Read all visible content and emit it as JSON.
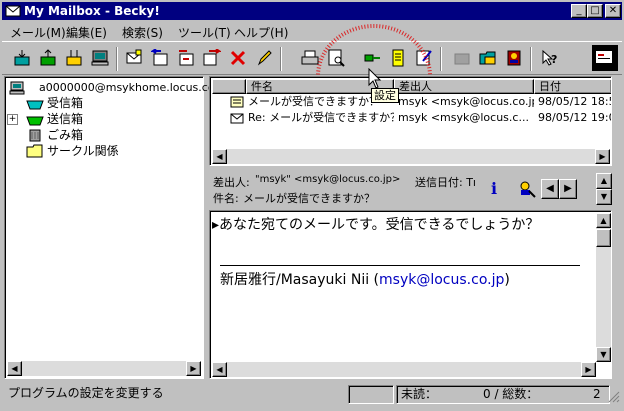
{
  "window": {
    "title": "My Mailbox - Becky!"
  },
  "menu": [
    "メール(M)",
    "編集(E)",
    "検索(S)",
    "ツール(T)",
    "ヘルプ(H)"
  ],
  "toolbar": {
    "icons": [
      "receive-icon",
      "send-icon",
      "send-receive-icon",
      "computer-icon",
      "new-mail-icon",
      "reply-icon",
      "reply-all-icon",
      "forward-icon",
      "delete-icon",
      "edit-icon",
      "print-icon",
      "preview-icon",
      "settings-icon",
      "notepad-icon",
      "edit-note-icon",
      "archive-icon",
      "folder-icon",
      "address-book-icon",
      "help-icon",
      "view-icon"
    ],
    "tooltip": "設定"
  },
  "tree": {
    "account": "a0000000@msykhome.locus.co.jp",
    "folders": [
      "受信箱",
      "送信箱",
      "ごみ箱",
      "サークル関係"
    ]
  },
  "list": {
    "columns": [
      "件名",
      "差出人",
      "日付"
    ],
    "rows": [
      {
        "subject": "メールが受信できますか？",
        "from": "msyk <msyk@locus.co.jp>",
        "date": "98/05/12 18:57..."
      },
      {
        "subject": "Re: メールが受信できますか？",
        "from": "msyk <msyk@locus.c...",
        "date": "98/05/12 19:09..."
      }
    ]
  },
  "header": {
    "from_label": "差出人:",
    "from_value": "\"msyk\" <msyk@locus.co.jp>",
    "date_label": "送信日付: Tı",
    "subject_label": "件名:",
    "subject_value": "メールが受信できますか？"
  },
  "message": {
    "line1": "▸あなた宛てのメールです。受信できるでしょうか？",
    "signature_name": "新居雅行/Masayuki Nii (",
    "signature_email": "msyk@locus.co.jp",
    "signature_close": ")"
  },
  "status": {
    "text": "プログラムの設定を変更する",
    "unread_label": "未読：",
    "counts": "0 / 総数：",
    "total": "2"
  },
  "colors": {
    "titlebar": "#000080",
    "link": "#0000c0",
    "face": "#c0c0c0"
  }
}
